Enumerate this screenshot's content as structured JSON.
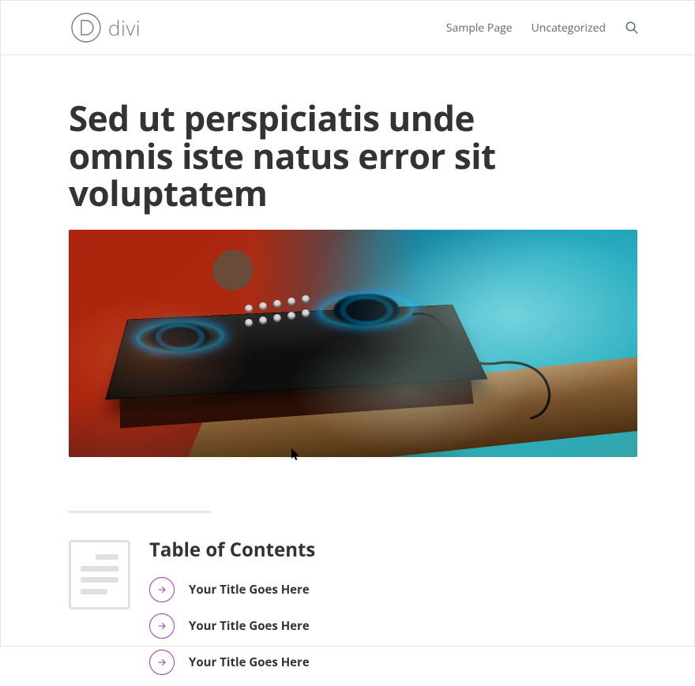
{
  "header": {
    "logo_word": "divi",
    "nav": [
      {
        "label": "Sample Page"
      },
      {
        "label": "Uncategorized"
      }
    ]
  },
  "post": {
    "title": "Sed ut perspiciatis unde omnis iste natus error sit voluptatem"
  },
  "toc": {
    "heading": "Table of Contents",
    "items": [
      {
        "label": "Your Title Goes Here"
      },
      {
        "label": "Your Title Goes Here"
      },
      {
        "label": "Your Title Goes Here"
      }
    ]
  },
  "colors": {
    "accent": "#a436b8",
    "text": "#333333",
    "nav": "#5f6b76"
  }
}
